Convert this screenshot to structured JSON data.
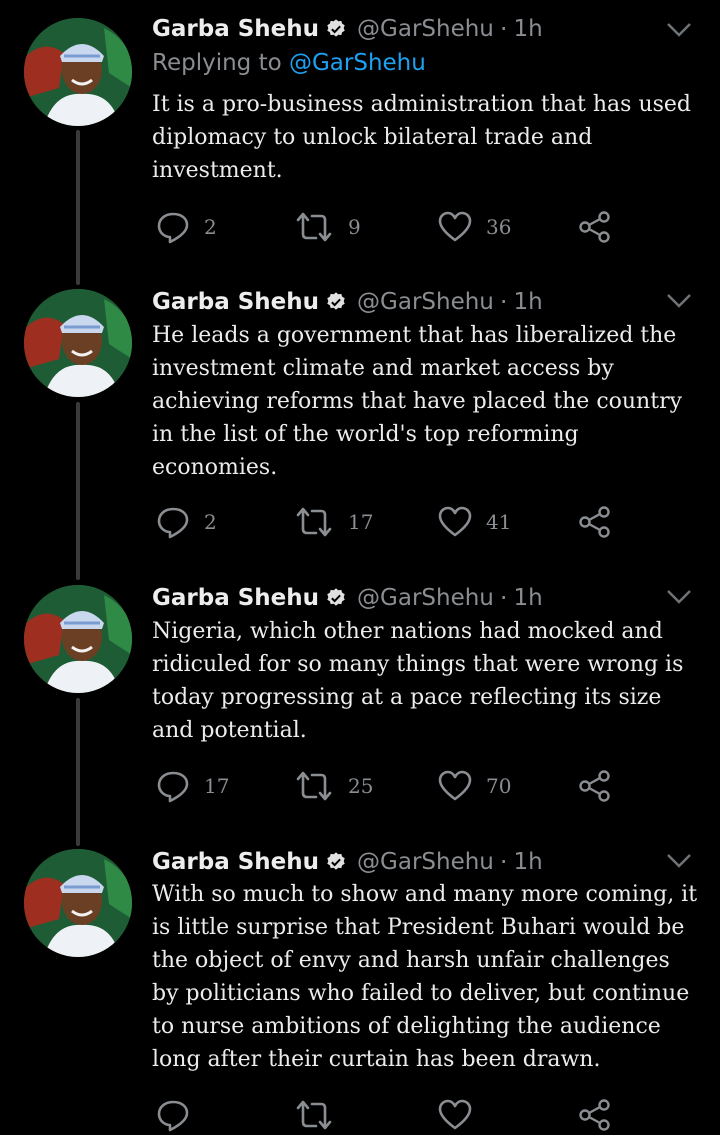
{
  "tweets": [
    {
      "name": "Garba Shehu",
      "handle": "@GarShehu",
      "time": "1h",
      "replying_label": "Replying to",
      "replying_to": "@GarShehu",
      "text": "It is a pro-business administration that has used diplomacy to unlock bilateral trade and investment.",
      "replies": "2",
      "retweets": "9",
      "likes": "36"
    },
    {
      "name": "Garba Shehu",
      "handle": "@GarShehu",
      "time": "1h",
      "text": "He leads a government that has liberalized the investment climate and market access by achieving reforms that have placed the country in the list of the world's top reforming economies.",
      "replies": "2",
      "retweets": "17",
      "likes": "41"
    },
    {
      "name": "Garba Shehu",
      "handle": "@GarShehu",
      "time": "1h",
      "text": "Nigeria, which other nations had mocked and ridiculed for so many things that were wrong is today progressing at a pace reflecting its size and potential.",
      "replies": "17",
      "retweets": "25",
      "likes": "70"
    },
    {
      "name": "Garba Shehu",
      "handle": "@GarShehu",
      "time": "1h",
      "text": "With so much to show and many more coming, it is little surprise that President Buhari would be the object of envy and harsh unfair challenges by politicians who failed to deliver, but continue to nurse ambitions of delighting the audience long after their curtain has been drawn.",
      "replies": "",
      "retweets": "",
      "likes": ""
    }
  ],
  "icons": {
    "verified": "verified-badge-icon",
    "chevron": "chevron-down-icon",
    "reply": "reply-icon",
    "retweet": "retweet-icon",
    "like": "heart-icon",
    "share": "share-icon"
  },
  "colors": {
    "background": "#000000",
    "text": "#ececec",
    "muted": "#8a8d91",
    "link": "#1da1f2",
    "thread_line": "#3a3a3a"
  }
}
